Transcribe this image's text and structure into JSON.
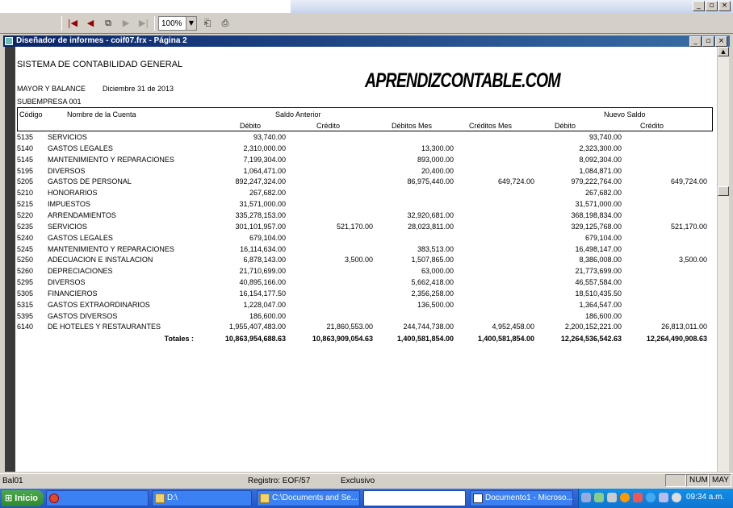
{
  "window": {
    "inner_title": "Diseñador de informes - coif07.frx - Página 2"
  },
  "toolbar": {
    "zoom_value": "100%"
  },
  "report": {
    "system_title": "SISTEMA DE CONTABILIDAD GENERAL",
    "report_name": "MAYOR Y BALANCE",
    "report_date": "Diciembre 31 de 2013",
    "subcompany": "SUBEMPRESA 001",
    "watermark": "APRENDIZCONTABLE.COM",
    "headers": {
      "code": "Código",
      "name": "Nombre de la Cuenta",
      "prev_balance": "Saldo Anterior",
      "new_balance": "Nuevo Saldo",
      "debit": "Débito",
      "credit": "Crédito",
      "month_debits": "Débitos Mes",
      "month_credits": "Créditos Mes",
      "debit2": "Débito",
      "credit2": "Crédito"
    },
    "rows": [
      {
        "code": "5135",
        "name": "SERVICIOS",
        "prev_debit": "93,740.00",
        "prev_credit": "",
        "month_debits": "",
        "month_credits": "",
        "new_debit": "93,740.00",
        "new_credit": ""
      },
      {
        "code": "5140",
        "name": "GASTOS LEGALES",
        "prev_debit": "2,310,000.00",
        "prev_credit": "",
        "month_debits": "13,300.00",
        "month_credits": "",
        "new_debit": "2,323,300.00",
        "new_credit": ""
      },
      {
        "code": "5145",
        "name": "MANTENIMIENTO Y REPARACIONES",
        "prev_debit": "7,199,304.00",
        "prev_credit": "",
        "month_debits": "893,000.00",
        "month_credits": "",
        "new_debit": "8,092,304.00",
        "new_credit": ""
      },
      {
        "code": "5195",
        "name": "DIVERSOS",
        "prev_debit": "1,064,471.00",
        "prev_credit": "",
        "month_debits": "20,400.00",
        "month_credits": "",
        "new_debit": "1,084,871.00",
        "new_credit": ""
      },
      {
        "code": "5205",
        "name": "GASTOS DE PERSONAL",
        "prev_debit": "892,247,324.00",
        "prev_credit": "",
        "month_debits": "86,975,440.00",
        "month_credits": "649,724.00",
        "new_debit": "979,222,764.00",
        "new_credit": "649,724.00"
      },
      {
        "code": "5210",
        "name": "HONORARIOS",
        "prev_debit": "267,682.00",
        "prev_credit": "",
        "month_debits": "",
        "month_credits": "",
        "new_debit": "267,682.00",
        "new_credit": ""
      },
      {
        "code": "5215",
        "name": "IMPUESTOS",
        "prev_debit": "31,571,000.00",
        "prev_credit": "",
        "month_debits": "",
        "month_credits": "",
        "new_debit": "31,571,000.00",
        "new_credit": ""
      },
      {
        "code": "5220",
        "name": "ARRENDAMIENTOS",
        "prev_debit": "335,278,153.00",
        "prev_credit": "",
        "month_debits": "32,920,681.00",
        "month_credits": "",
        "new_debit": "368,198,834.00",
        "new_credit": ""
      },
      {
        "code": "5235",
        "name": "SERVICIOS",
        "prev_debit": "301,101,957.00",
        "prev_credit": "521,170.00",
        "month_debits": "28,023,811.00",
        "month_credits": "",
        "new_debit": "329,125,768.00",
        "new_credit": "521,170.00"
      },
      {
        "code": "5240",
        "name": "GASTOS LEGALES",
        "prev_debit": "679,104.00",
        "prev_credit": "",
        "month_debits": "",
        "month_credits": "",
        "new_debit": "679,104.00",
        "new_credit": ""
      },
      {
        "code": "5245",
        "name": "MANTENIMIENTO Y REPARACIONES",
        "prev_debit": "16,114,634.00",
        "prev_credit": "",
        "month_debits": "383,513.00",
        "month_credits": "",
        "new_debit": "16,498,147.00",
        "new_credit": ""
      },
      {
        "code": "5250",
        "name": "ADECUACION E INSTALACION",
        "prev_debit": "6,878,143.00",
        "prev_credit": "3,500.00",
        "month_debits": "1,507,865.00",
        "month_credits": "",
        "new_debit": "8,386,008.00",
        "new_credit": "3,500.00"
      },
      {
        "code": "5260",
        "name": "DEPRECIACIONES",
        "prev_debit": "21,710,699.00",
        "prev_credit": "",
        "month_debits": "63,000.00",
        "month_credits": "",
        "new_debit": "21,773,699.00",
        "new_credit": ""
      },
      {
        "code": "5295",
        "name": "DIVERSOS",
        "prev_debit": "40,895,166.00",
        "prev_credit": "",
        "month_debits": "5,662,418.00",
        "month_credits": "",
        "new_debit": "46,557,584.00",
        "new_credit": ""
      },
      {
        "code": "5305",
        "name": "FINANCIEROS",
        "prev_debit": "16,154,177.50",
        "prev_credit": "",
        "month_debits": "2,356,258.00",
        "month_credits": "",
        "new_debit": "18,510,435.50",
        "new_credit": ""
      },
      {
        "code": "5315",
        "name": "GASTOS EXTRAORDINARIOS",
        "prev_debit": "1,228,047.00",
        "prev_credit": "",
        "month_debits": "136,500.00",
        "month_credits": "",
        "new_debit": "1,364,547.00",
        "new_credit": ""
      },
      {
        "code": "5395",
        "name": "GASTOS DIVERSOS",
        "prev_debit": "186,600.00",
        "prev_credit": "",
        "month_debits": "",
        "month_credits": "",
        "new_debit": "186,600.00",
        "new_credit": ""
      },
      {
        "code": "6140",
        "name": "DE HOTELES Y RESTAURANTES",
        "prev_debit": "1,955,407,483.00",
        "prev_credit": "21,860,553.00",
        "month_debits": "244,744,738.00",
        "month_credits": "4,952,458.00",
        "new_debit": "2,200,152,221.00",
        "new_credit": "26,813,011.00"
      }
    ],
    "totals": {
      "label": "Totales :",
      "prev_debit": "10,863,954,688.63",
      "prev_credit": "10,863,909,054.63",
      "month_debits": "1,400,581,854.00",
      "month_credits": "1,400,581,854.00",
      "new_debit": "12,264,536,542.63",
      "new_credit": "12,264,490,908.63"
    }
  },
  "status": {
    "table": "Bal01",
    "record": "Registro: EOF/57",
    "mode": "Exclusivo",
    "num": "NUM",
    "may": "MAY"
  },
  "taskbar": {
    "start": "Inicio",
    "item_drive": "D:\\",
    "item_docs": "C:\\Documents and Se...",
    "item_word": "Documento1 - Microso...",
    "clock": "09:34 a.m."
  }
}
